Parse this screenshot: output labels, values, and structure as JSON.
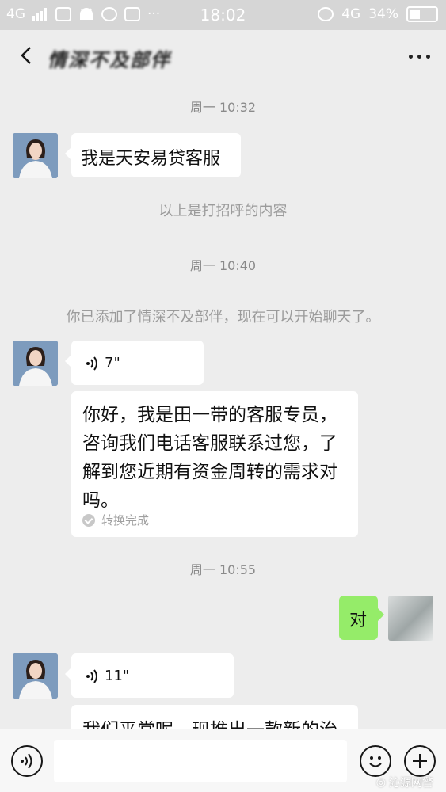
{
  "status_bar": {
    "network_left": "4G",
    "time": "18:02",
    "network_right": "4G",
    "battery_percent": "34%"
  },
  "nav": {
    "title": "情深不及部伴"
  },
  "messages": {
    "time_1": "周一 10:32",
    "text_1": "我是天安易贷客服",
    "system_1": "以上是打招呼的内容",
    "time_2": "周一 10:40",
    "system_2": "你已添加了情深不及部伴，现在可以开始聊天了。",
    "voice_1_duration": "7\"",
    "transcript_1": "你好，我是田一带的客服专员，咨询我们电话客服联系过您，了解到您近期有资金周转的需求对吗。",
    "transcript_1_status": "转换完成",
    "time_3": "周一 10:55",
    "my_reply": "对",
    "voice_2_duration": "11\"",
    "transcript_2_partial": "我们平常呢，现推出一款新的治"
  },
  "input_bar": {
    "placeholder": ""
  },
  "watermark": {
    "text": "沁源网警"
  },
  "colors": {
    "background": "#ededed",
    "status_bar": "#d6d6d6",
    "my_bubble": "#95ec69",
    "their_bubble": "#ffffff"
  },
  "icons": {
    "status_left": [
      "signal-icon",
      "wallet-icon",
      "android-icon",
      "message-icon",
      "s-icon",
      "more-icon"
    ],
    "status_right": [
      "alarm-icon",
      "signal-icon",
      "battery-icon"
    ]
  }
}
